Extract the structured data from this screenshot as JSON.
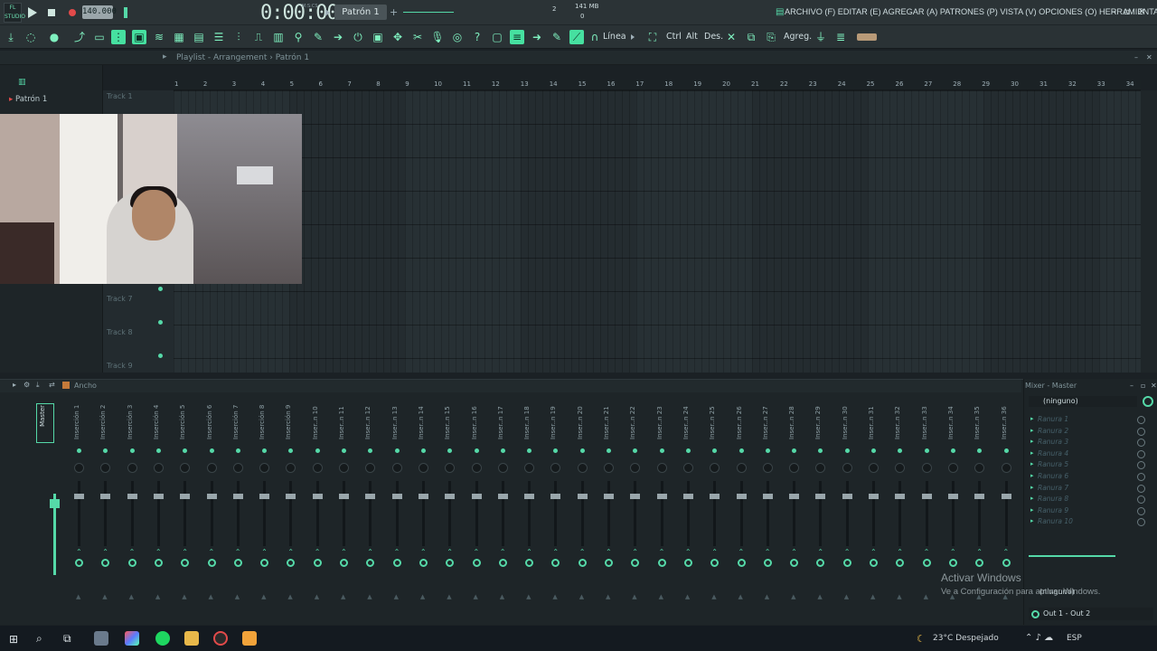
{
  "toolbar": {
    "logo_text": "FL STUDIO",
    "tempo": "140.000",
    "time": "0:00:00",
    "time_unit": "M:S:CS",
    "pattern": "Patrón 1",
    "cpu": "2",
    "memory": "141 MB",
    "mem_sub": "0",
    "menu": "ARCHIVO (F) EDITAR (E) AGREGAR (A) PATRONES (P) VISTA (V) OPCIONES (O) HERRAMIENTAS (T) AYUDA",
    "linea_label": "Línea",
    "ctrl_label": "Ctrl",
    "alt_label": "Alt",
    "des_label": "Des.",
    "agreg_label": "Agreg."
  },
  "playlist": {
    "title": "Playlist - Arrangement",
    "pattern_crumb": "Patrón 1",
    "patron_item": "Patrón 1",
    "tracks": [
      "Track 1",
      "Track 7",
      "Track 8",
      "Track 9"
    ],
    "ruler": [
      "1",
      "2",
      "3",
      "4",
      "5",
      "6",
      "7",
      "8",
      "9",
      "10",
      "11",
      "12",
      "13",
      "14",
      "15",
      "16",
      "17",
      "18",
      "19",
      "20",
      "21",
      "22",
      "23",
      "24",
      "25",
      "26",
      "27",
      "28",
      "29",
      "30",
      "31",
      "32",
      "33",
      "34"
    ]
  },
  "mixer": {
    "title": "Ancho",
    "master_label": "Master",
    "inserts": [
      "Inserción 1",
      "Inserción 2",
      "Inserción 3",
      "Inserción 4",
      "Inserción 5",
      "Inserción 6",
      "Inserción 7",
      "Inserción 8",
      "Inserción 9",
      "Inser..n 10",
      "Inser..n 11",
      "Inser..n 12",
      "Inser..n 13",
      "Inser..n 14",
      "Inser..n 15",
      "Inser..n 16",
      "Inser..n 17",
      "Inser..n 18",
      "Inser..n 19",
      "Inser..n 20",
      "Inser..n 21",
      "Inser..n 22",
      "Inser..n 23",
      "Inser..n 24",
      "Inser..n 25",
      "Inser..n 26",
      "Inser..n 27",
      "Inser..n 28",
      "Inser..n 29",
      "Inser..n 30",
      "Inser..n 31",
      "Inser..n 32",
      "Inser..n 33",
      "Inser..n 34",
      "Inser..n 35",
      "Inser..n 36"
    ],
    "right_title": "Mixer - Master",
    "input": "(ninguno)",
    "slots": [
      "Ranura 1",
      "Ranura 2",
      "Ranura 3",
      "Ranura 4",
      "Ranura 5",
      "Ranura 6",
      "Ranura 7",
      "Ranura 8",
      "Ranura 9",
      "Ranura 10"
    ],
    "output_in": "(ninguno)",
    "output": "Out 1 - Out 2"
  },
  "watermark": {
    "line1": "Activar Windows",
    "line2": "Ve a Configuración para activar Windows."
  },
  "taskbar": {
    "weather": "23°C  Despejado",
    "lang": "ESP"
  },
  "colors": {
    "accent": "#55d9a8",
    "background": "#1e2528"
  }
}
